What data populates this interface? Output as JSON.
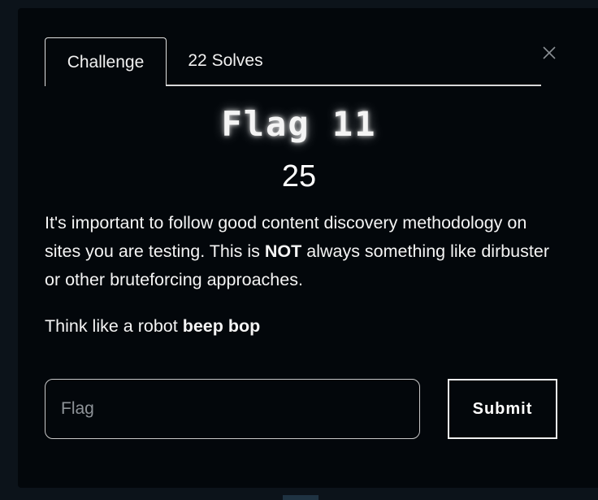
{
  "tabs": [
    {
      "label": "Challenge",
      "active": true
    },
    {
      "label": "22 Solves",
      "active": false
    }
  ],
  "challenge": {
    "name": "Flag 11",
    "points": "25",
    "description": {
      "part1": "It's important to follow good content discovery methodology on sites you are testing. This is ",
      "emphasis": "NOT",
      "part2": " always something like dirbuster or other bruteforcing approaches."
    },
    "hint": {
      "text": "Think like a robot ",
      "emphasis": "beep bop"
    }
  },
  "form": {
    "placeholder": "Flag",
    "value": "",
    "submit_label": "Submit"
  },
  "icons": {
    "close": "close-icon"
  },
  "colors": {
    "modal_bg": "#03070b",
    "text": "#f4f4f4",
    "border": "#e0e0e0"
  }
}
